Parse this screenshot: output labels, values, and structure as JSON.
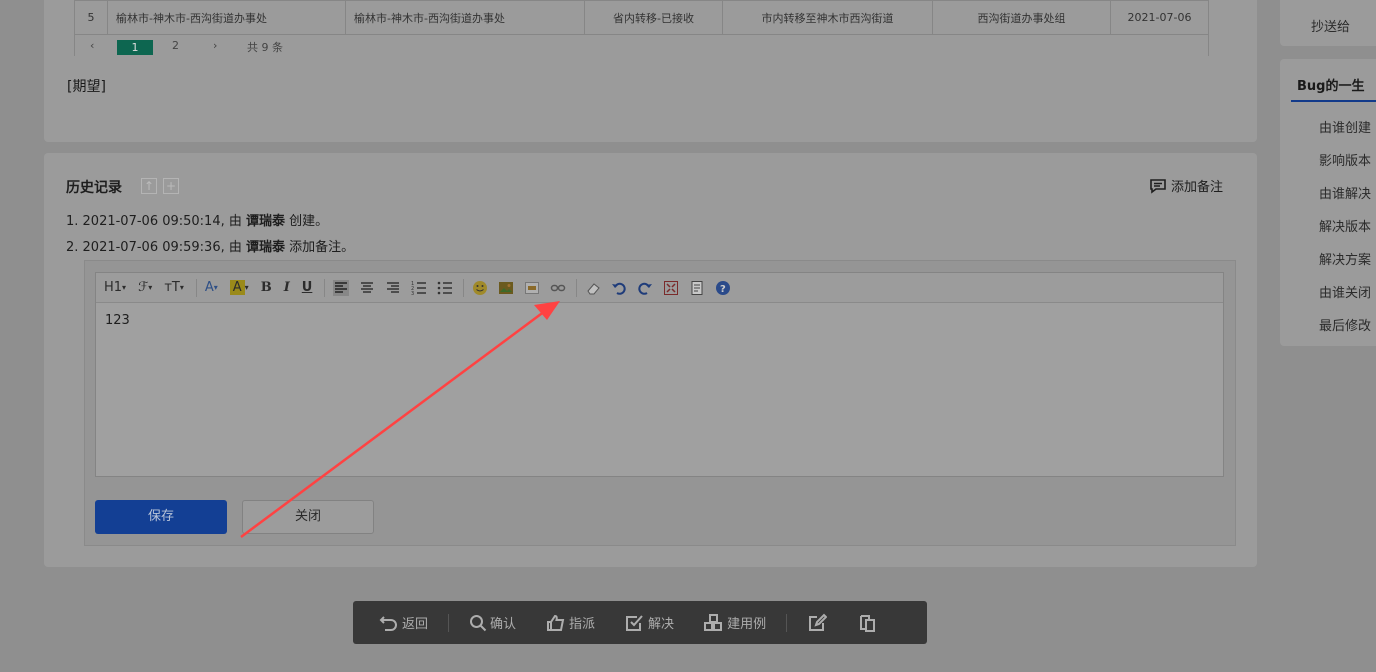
{
  "case_table": {
    "row": {
      "no": "5",
      "col2": "榆林市-神木市-西沟街道办事处",
      "col3": "榆林市-神木市-西沟街道办事处",
      "status": "省内转移-已接收",
      "note": "市内转移至神木市西沟街道",
      "dept": "西沟街道办事处组",
      "date": "2021-07-06"
    },
    "pager": {
      "prev": "‹",
      "current": "1",
      "page2": "2",
      "next": "›",
      "total": "共 9 条"
    }
  },
  "expect_label": "[期望]",
  "history": {
    "title": "历史记录",
    "add_note": "添加备注",
    "entries": [
      {
        "prefix": "1. 2021-07-06 09:50:14, 由 ",
        "user": "谭瑞泰",
        "action": " 创建。"
      },
      {
        "prefix": "2. 2021-07-06 09:59:36, 由 ",
        "user": "谭瑞泰",
        "action": " 添加备注。"
      }
    ]
  },
  "editor": {
    "toolbar": {
      "heading": "H1",
      "font_family": "ℱ",
      "font_size": "ᴛT",
      "font_color": "A",
      "bg_color": "A",
      "bold": "B",
      "italic": "I",
      "underline": "U"
    },
    "content": "123",
    "save": "保存",
    "close": "关闭"
  },
  "actions": {
    "back": "返回",
    "confirm": "确认",
    "assign": "指派",
    "resolve": "解决",
    "create_case": "建用例"
  },
  "sidebar": {
    "cc_label": "抄送给",
    "life_title": "Bug的一生",
    "life_items": [
      "由谁创建",
      "影响版本",
      "由谁解决",
      "解决版本",
      "解决方案",
      "由谁关闭",
      "最后修改"
    ]
  },
  "colors": {
    "arrow": "#ff4242",
    "save_button": "#133f94",
    "pager_active": "#0d6650",
    "action_bar": "#383838"
  }
}
